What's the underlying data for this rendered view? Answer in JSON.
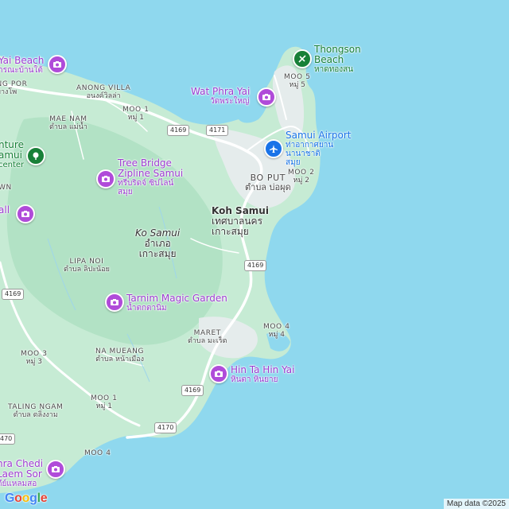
{
  "colors": {
    "water": "#8fd8ee",
    "land": "#bfe8cf",
    "forest": "#a9ddbd",
    "urban": "#e9ecef",
    "road": "#ffffff",
    "poi_purple": "#9d3bd1",
    "airport_blue": "#1a73e8",
    "park_green": "#188038"
  },
  "map": {
    "city": {
      "name1": "Koh Samui",
      "name2": "เทศบาลนคร",
      "name3": "เกาะสมุย"
    },
    "district": {
      "name1": "Ko Samui",
      "name2": "อำเภอ",
      "name3": "เกาะสมุย"
    },
    "areas": [
      {
        "id": "anong-villa",
        "name": "ANONG VILLA",
        "sub": "อนงค์วิลล่า"
      },
      {
        "id": "bang-por",
        "name": "BANG POR",
        "sub": "บางโพ"
      },
      {
        "id": "moo1-north",
        "name": "MOO 1",
        "sub": "หมู่ 1"
      },
      {
        "id": "mae-nam",
        "name": "MAE NAM",
        "sub": "ตำบล แม่น้ำ"
      },
      {
        "id": "moo5",
        "name": "MOO 5",
        "sub": "หมู่ 5"
      },
      {
        "id": "bo-put",
        "name": "BO PUT",
        "sub": "ตำบล บ่อผุด"
      },
      {
        "id": "moo2",
        "name": "MOO 2",
        "sub": "หมู่ 2"
      },
      {
        "id": "town",
        "name": "WN",
        "sub": ""
      },
      {
        "id": "lipa-noi",
        "name": "LIPA NOI",
        "sub": "ตำบล ลิปะน้อย"
      },
      {
        "id": "maret",
        "name": "MARET",
        "sub": "ตำบล มะเร็ต"
      },
      {
        "id": "moo4-east",
        "name": "MOO 4",
        "sub": "หมู่ 4"
      },
      {
        "id": "moo3",
        "name": "MOO 3",
        "sub": "หมู่ 3"
      },
      {
        "id": "na-mueang",
        "name": "NA MUEANG",
        "sub": "ตำบล หน้าเมือง"
      },
      {
        "id": "moo1-south",
        "name": "MOO 1",
        "sub": "หมู่ 1"
      },
      {
        "id": "taling-ngam",
        "name": "TALING NGAM",
        "sub": "ตำบล ตลิ่งงาม"
      },
      {
        "id": "moo4-south",
        "name": "MOO 4",
        "sub": ""
      }
    ],
    "pois": [
      {
        "id": "lamai-beach",
        "kind": "photo",
        "name": "Yai Beach",
        "sub": "ารณะบ้านใต้"
      },
      {
        "id": "thongson-beach",
        "kind": "tree",
        "name": "Thongson Beach",
        "sub": "หาดทองสน"
      },
      {
        "id": "wat-phra-yai",
        "kind": "photo",
        "name": "Wat Phra Yai",
        "sub": "วัดพระใหญ่"
      },
      {
        "id": "samui-airport",
        "kind": "plane",
        "name": "Samui Airport",
        "sub": "ท่าอากาศยานนานาชาติสมุย"
      },
      {
        "id": "adventure",
        "kind": "tree",
        "name": "nture amui",
        "sub": "center"
      },
      {
        "id": "tree-bridge",
        "kind": "photo",
        "name": "Tree Bridge Zipline Samui",
        "sub": "ทรีบริดจ์ ซิปไลน์ สมุย"
      },
      {
        "id": "waterfall",
        "kind": "photo",
        "name": "all",
        "sub": ""
      },
      {
        "id": "tarnim",
        "kind": "photo",
        "name": "Tarnim Magic Garden",
        "sub": "น้ำตกตานิ่ม"
      },
      {
        "id": "hin-ta-hin-yai",
        "kind": "photo",
        "name": "Hin Ta Hin Yai",
        "sub": "หินตา หินยาย"
      },
      {
        "id": "phra-chedi",
        "kind": "photo",
        "name": "hra Chedi Laem Sor",
        "sub": "ดีย์แหลมสอ"
      }
    ],
    "shields": [
      {
        "id": "r4169-a",
        "text": "4169"
      },
      {
        "id": "r4171",
        "text": "4171"
      },
      {
        "id": "r4169-b",
        "text": "4169"
      },
      {
        "id": "r4169-c",
        "text": "4169"
      },
      {
        "id": "r4169-d",
        "text": "4169"
      },
      {
        "id": "r4170-a",
        "text": "4170"
      },
      {
        "id": "r4170-b",
        "text": "470"
      }
    ]
  },
  "footer": {
    "google": "Google",
    "attribution": "Map data ©2025"
  }
}
